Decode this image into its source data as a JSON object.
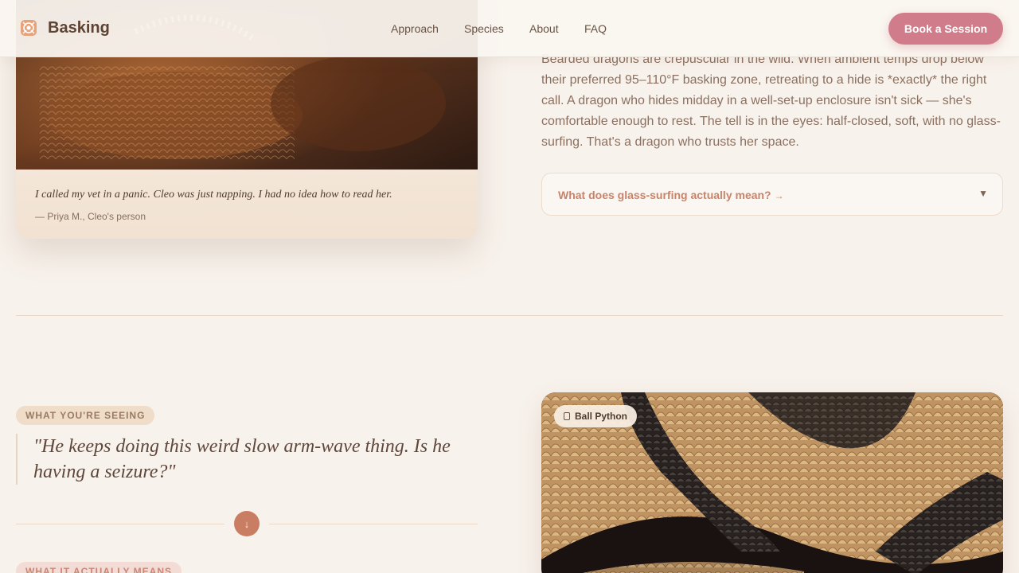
{
  "header": {
    "brand": "Basking",
    "logo_icon": "scales-emblem-icon",
    "nav": [
      "Approach",
      "Species",
      "About",
      "FAQ"
    ],
    "cta": "Book a Session"
  },
  "testimonial": {
    "quote": "I called my vet in a panic. Cleo was just napping. I had no idea how to read her.",
    "attribution": "— Priya M., Cleo's person"
  },
  "explanation": {
    "body": "Bearded dragons are crepuscular in the wild. When ambient temps drop below their preferred 95–110°F basking zone, retreating to a hide is *exactly* the right call. A dragon who hides midday in a well-set-up enclosure isn't sick — she's comfortable enough to rest. The tell is in the eyes: half-closed, soft, with no glass-surfing. That's a dragon who trusts her space.",
    "faq_question": "What does glass-surfing actually mean?",
    "faq_arrow": "→",
    "faq_chevron": "▼"
  },
  "scenario": {
    "label": "WHAT YOU'RE SEEING",
    "quote": "\"He keeps doing this weird slow arm-wave thing. Is he having a seizure?\"",
    "next_icon": "↓",
    "next_label": "WHAT IT ACTUALLY MEANS",
    "species_tag": "Ball Python"
  },
  "colors": {
    "background": "#f8f2ec",
    "cta": "#d17c8a",
    "accent": "#c97e64",
    "faq_text": "#c9836a"
  }
}
